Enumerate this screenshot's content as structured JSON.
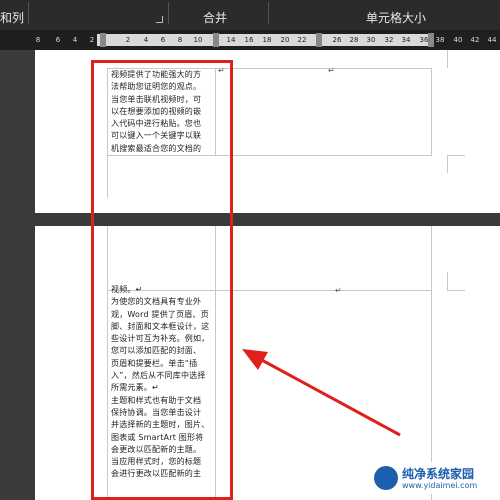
{
  "ribbon": {
    "group_left": "和列",
    "group_merge": "合并",
    "group_cell_size": "单元格大小"
  },
  "ruler": {
    "ticks": [
      "8",
      "6",
      "4",
      "2",
      "2",
      "4",
      "6",
      "8",
      "10",
      "14",
      "16",
      "18",
      "20",
      "22",
      "26",
      "28",
      "30",
      "32",
      "34",
      "36",
      "38",
      "40",
      "42",
      "44"
    ]
  },
  "page1": {
    "lines": [
      "视频提供了功能强大的方",
      "法帮助您证明您的观点。",
      "当您单击联机视频时，可",
      "以在想要添加的视频的嵌",
      "入代码中进行粘贴。您也",
      "可以键入一个关键字以联",
      "机搜索最适合您的文档的"
    ],
    "cell_mark": "↵",
    "end_mark": "↵"
  },
  "page2": {
    "lines": [
      "视频。↵",
      "为使您的文档具有专业外",
      "观，Word 提供了页眉、页",
      "脚、封面和文本框设计，这",
      "些设计可互为补充。例如，",
      "您可以添加匹配的封面、",
      "页眉和提要栏。单击“插",
      "入”，然后从不同库中选择",
      "所需元素。↵",
      "主题和样式也有助于文档",
      "保持协调。当您单击设计",
      "并选择新的主题时，图片、",
      "图表或 SmartArt 图形将",
      "会更改以匹配新的主题。",
      "当应用样式时，您的标题",
      "会进行更改以匹配新的主"
    ],
    "cell_mark": "↵"
  },
  "watermark": {
    "title": "纯净系统家园",
    "url": "www.yidaimei.com"
  },
  "colors": {
    "highlight": "#e0201c",
    "arrow": "#e0201c"
  }
}
